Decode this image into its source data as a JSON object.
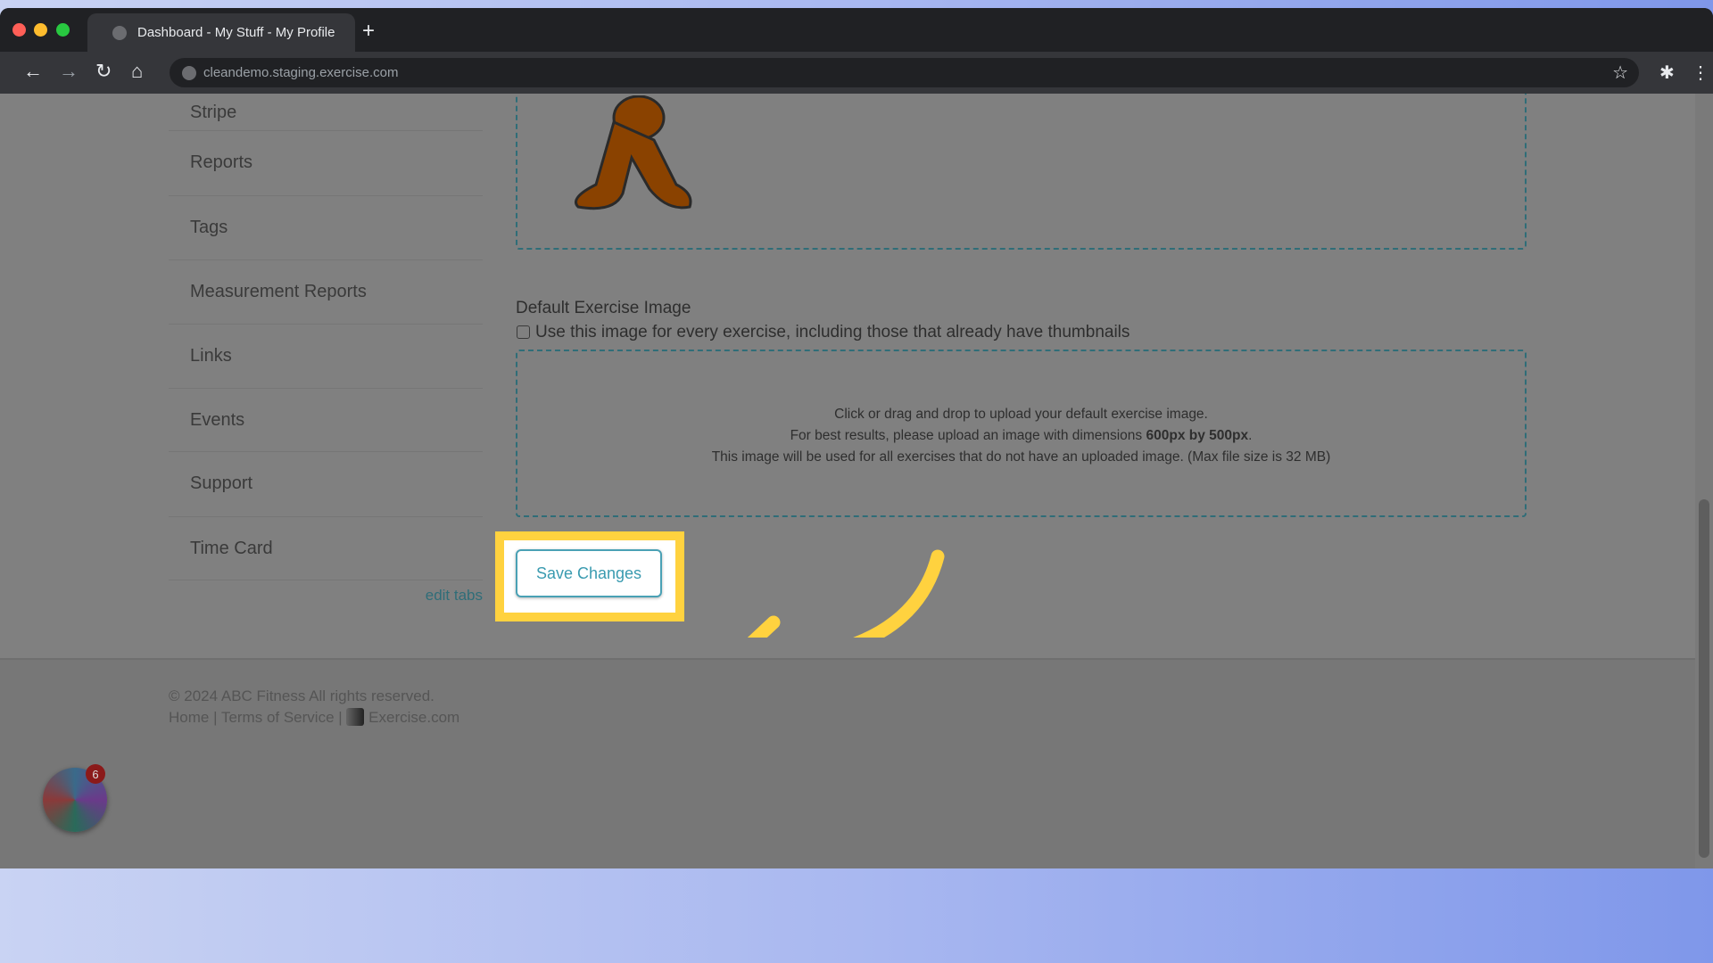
{
  "browser": {
    "tab_title": "Dashboard - My Stuff - My Profile",
    "new_tab": "+",
    "url": "cleandemo.staging.exercise.com",
    "back": "←",
    "forward": "→",
    "reload": "↻",
    "home": "⌂",
    "star": "☆",
    "extensions": "✱",
    "menu": "⋮"
  },
  "sidebar": {
    "items": [
      {
        "label": "Stripe"
      },
      {
        "label": "Reports"
      },
      {
        "label": "Tags"
      },
      {
        "label": "Measurement Reports"
      },
      {
        "label": "Links"
      },
      {
        "label": "Events"
      },
      {
        "label": "Support"
      },
      {
        "label": "Time Card"
      }
    ],
    "edit_tabs": "edit tabs"
  },
  "main": {
    "default_image_heading": "Default Exercise Image",
    "checkbox_label": "Use this image for every exercise, including those that already have thumbnails",
    "checkbox_checked": false,
    "dropzone": {
      "line1": "Click or drag and drop to upload your default exercise image.",
      "line2_prefix": "For best results, please upload an image with dimensions ",
      "line2_bold": "600px by 500px",
      "line2_suffix": ".",
      "line3": "This image will be used for all exercises that do not have an uploaded image. (Max file size is 32 MB)"
    },
    "save_label": "Save Changes"
  },
  "footer": {
    "copyright": "© 2024 ABC Fitness All rights reserved.",
    "home": "Home",
    "sep": "|",
    "terms": "Terms of Service",
    "brand": "Exercise.com"
  },
  "widget": {
    "badge_count": "6"
  },
  "colors": {
    "highlight": "#ffd23f",
    "accent": "#3a9bb0",
    "overlay": "#808080"
  }
}
